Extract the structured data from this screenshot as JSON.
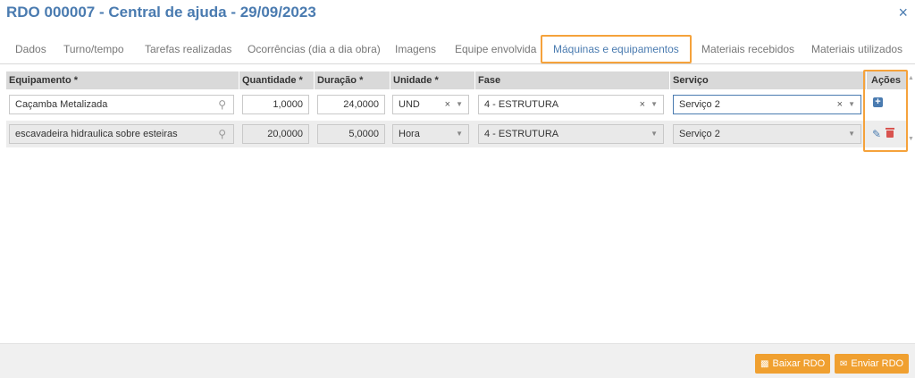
{
  "window": {
    "title": "RDO 000007 - Central de ajuda - 29/09/2023",
    "close_icon": "×"
  },
  "tabs": [
    {
      "label": "Dados",
      "active": false
    },
    {
      "label": "Turno/tempo",
      "active": false
    },
    {
      "label": "Tarefas realizadas",
      "active": false
    },
    {
      "label": "Ocorrências (dia a dia obra)",
      "active": false
    },
    {
      "label": "Imagens",
      "active": false
    },
    {
      "label": "Equipe envolvida",
      "active": false
    },
    {
      "label": "Máquinas e equipamentos",
      "active": true
    },
    {
      "label": "Materiais recebidos",
      "active": false
    },
    {
      "label": "Materiais utilizados",
      "active": false
    }
  ],
  "grid": {
    "columns": [
      "Equipamento *",
      "Quantidade *",
      "Duração *",
      "Unidade *",
      "Fase",
      "Serviço",
      "Ações"
    ],
    "rows": [
      {
        "equipamento": "Caçamba Metalizada",
        "quantidade": "1,0000",
        "duracao": "24,0000",
        "unidade": "UND",
        "fase": "4 - ESTRUTURA",
        "servico": "Serviço 2",
        "editable": true
      },
      {
        "equipamento": "escavadeira hidraulica sobre esteiras",
        "quantidade": "20,0000",
        "duracao": "5,0000",
        "unidade": "Hora",
        "fase": "4 - ESTRUTURA",
        "servico": "Serviço 2",
        "editable": false
      }
    ]
  },
  "icons": {
    "search": "search-icon",
    "clear": "×",
    "dropdown": "▼",
    "add": "+",
    "edit": "✎",
    "delete": "trash-icon"
  },
  "footer": {
    "baixar_label": "Baixar RDO",
    "enviar_label": "Enviar RDO"
  },
  "colors": {
    "accent": "#4a7bb0",
    "highlight": "#f5a23b",
    "button": "#f0a030",
    "delete": "#d9534f"
  }
}
